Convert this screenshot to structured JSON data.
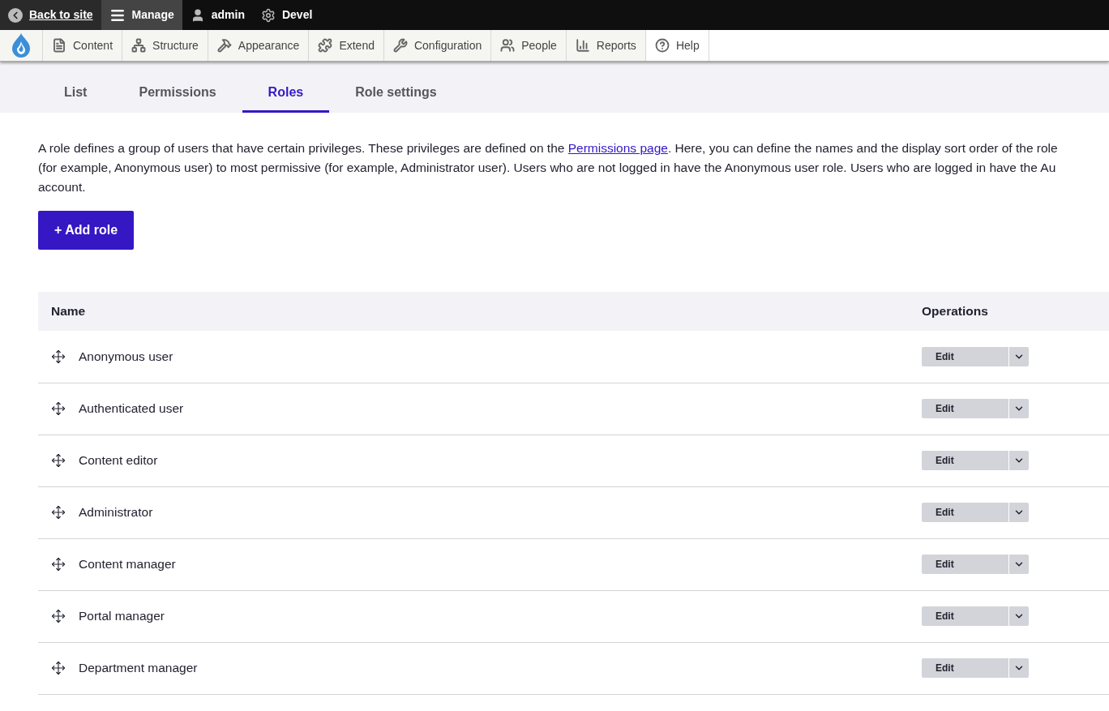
{
  "toolbar": {
    "items": [
      {
        "label": "Back to site",
        "kind": "back",
        "selected": false
      },
      {
        "label": "Manage",
        "kind": "manage",
        "selected": true
      },
      {
        "label": "admin",
        "kind": "user",
        "selected": false
      },
      {
        "label": "Devel",
        "kind": "devel",
        "selected": false
      }
    ]
  },
  "admin_menu": {
    "items": [
      {
        "label": "Content",
        "kind": "content"
      },
      {
        "label": "Structure",
        "kind": "structure"
      },
      {
        "label": "Appearance",
        "kind": "appearance"
      },
      {
        "label": "Extend",
        "kind": "extend"
      },
      {
        "label": "Configuration",
        "kind": "configuration"
      },
      {
        "label": "People",
        "kind": "people"
      },
      {
        "label": "Reports",
        "kind": "reports"
      },
      {
        "label": "Help",
        "kind": "help"
      }
    ]
  },
  "tabs": [
    {
      "label": "List",
      "selected": false
    },
    {
      "label": "Permissions",
      "selected": false
    },
    {
      "label": "Roles",
      "selected": true
    },
    {
      "label": "Role settings",
      "selected": false
    }
  ],
  "description": {
    "before": "A role defines a group of users that have certain privileges. These privileges are defined on the ",
    "link": "Permissions page",
    "after": ". Here, you can define the names and the display sort order of the role",
    "line_2": "(for example, Anonymous user) to most permissive (for example, Administrator user). Users who are not logged in have the Anonymous user role. Users who are logged in have the Au",
    "line_3": "account."
  },
  "add_button": "+ Add role",
  "table": {
    "columns": [
      "Name",
      "Operations"
    ],
    "rows": [
      {
        "name": "Anonymous user",
        "operation": "Edit"
      },
      {
        "name": "Authenticated user",
        "operation": "Edit"
      },
      {
        "name": "Content editor",
        "operation": "Edit"
      },
      {
        "name": "Administrator",
        "operation": "Edit"
      },
      {
        "name": "Content manager",
        "operation": "Edit"
      },
      {
        "name": "Portal manager",
        "operation": "Edit"
      },
      {
        "name": "Department manager",
        "operation": "Edit"
      }
    ]
  }
}
